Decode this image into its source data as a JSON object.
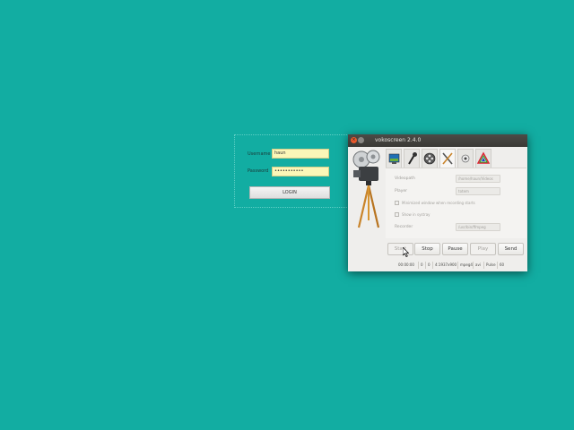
{
  "login": {
    "username_label": "Username",
    "username_value": "haun",
    "password_label": "Password",
    "password_value": "•••••••••••",
    "login_button": "LOGIN"
  },
  "window": {
    "title": "vokoscreen 2.4.0",
    "close_glyph": "×",
    "tabs": [
      {
        "icon": "screen-icon"
      },
      {
        "icon": "microphone-icon"
      },
      {
        "icon": "film-reel-icon"
      },
      {
        "icon": "tools-icon"
      },
      {
        "icon": "webcam-icon"
      },
      {
        "icon": "color-triangle-icon"
      }
    ],
    "pane": {
      "videoswith_label": "Videopath",
      "videoswith_value": "/home/haun/Videos",
      "player_label": "Player",
      "player_value": "totem",
      "minimize_checkbox": "Minimized window when recording starts",
      "systray_checkbox": "Show in systray",
      "recorder_label": "Recorder",
      "recorder_value": "/usr/bin/ffmpeg"
    },
    "controls": {
      "start": "Start",
      "stop": "Stop",
      "pause": "Pause",
      "play": "Play",
      "send": "Send"
    },
    "status": {
      "time": "00:00:00",
      "frames1": "0",
      "frames2": "0",
      "resolution": "4:1937x900",
      "codec": "mpeg4",
      "format": "avi",
      "audio": "Pulse",
      "fps": "60"
    }
  },
  "colors": {
    "desktop": "#12ada2",
    "titlebar": "#3c3b37",
    "close_button": "#e9592c",
    "login_field": "#fbf7b8"
  }
}
